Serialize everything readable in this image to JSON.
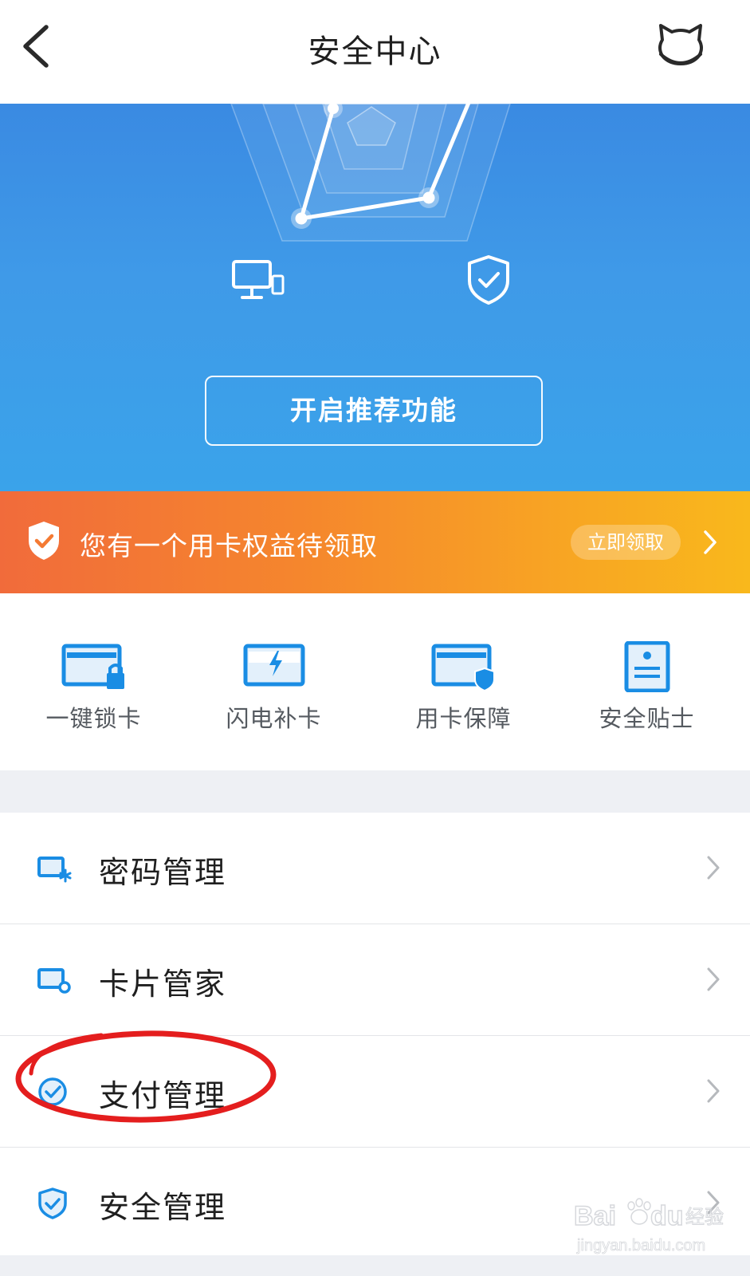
{
  "nav": {
    "title": "安全中心",
    "back_icon": "chevron-left-icon",
    "mascot_icon": "cat-mascot-icon"
  },
  "hero": {
    "cta_label": "开启推荐功能",
    "left_icon": "monitor-phone-icon",
    "right_icon": "shield-check-icon",
    "colors": {
      "top": "#3a8ae2",
      "bottom": "#3aa3ea"
    }
  },
  "promo": {
    "text": "您有一个用卡权益待领取",
    "button_label": "立即领取",
    "icon": "shield-check-icon",
    "colors": {
      "start": "#f16b3b",
      "end": "#f9b81c"
    }
  },
  "quick_actions": [
    {
      "label": "一键锁卡",
      "icon": "card-lock-icon"
    },
    {
      "label": "闪电补卡",
      "icon": "card-lightning-icon"
    },
    {
      "label": "用卡保障",
      "icon": "card-shield-icon"
    },
    {
      "label": "安全贴士",
      "icon": "tips-document-icon"
    }
  ],
  "menu": [
    {
      "label": "密码管理",
      "icon": "card-asterisk-icon"
    },
    {
      "label": "卡片管家",
      "icon": "card-gear-icon"
    },
    {
      "label": "支付管理",
      "icon": "check-circle-icon"
    },
    {
      "label": "安全管理",
      "icon": "shield-check-icon"
    }
  ],
  "accent_color": "#1a8de4",
  "watermark": {
    "brand": "Baidu经验",
    "url": "jingyan.baidu.com"
  }
}
